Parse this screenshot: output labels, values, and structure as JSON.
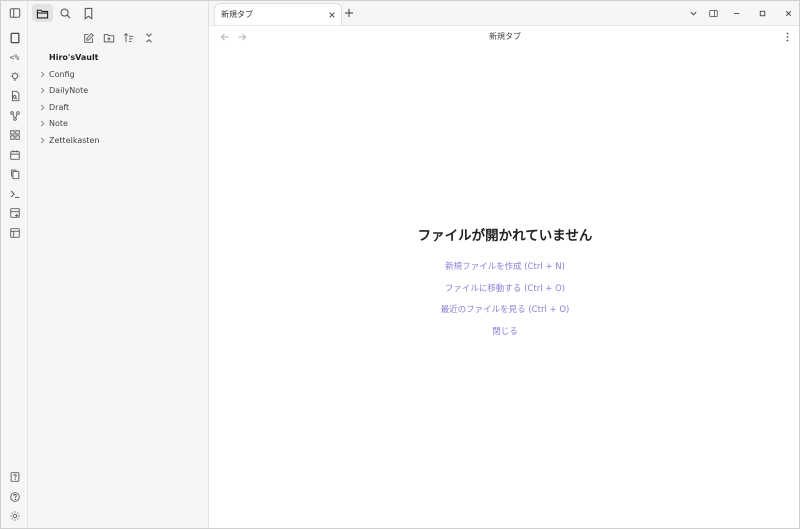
{
  "sidebar": {
    "vault_name": "Hiro'sVault",
    "folders": [
      {
        "label": "Config"
      },
      {
        "label": "DailyNote"
      },
      {
        "label": "Draft"
      },
      {
        "label": "Note"
      },
      {
        "label": "Zettelkasten"
      }
    ]
  },
  "tabs": [
    {
      "label": "新規タブ"
    }
  ],
  "view": {
    "title": "新規タブ",
    "empty_state": {
      "heading": "ファイルが開かれていません",
      "actions": [
        {
          "label": "新規ファイルを作成 (Ctrl + N)"
        },
        {
          "label": "ファイルに移動する (Ctrl + O)"
        },
        {
          "label": "最近のファイルを見る (Ctrl + O)"
        },
        {
          "label": "閉じる"
        }
      ]
    }
  },
  "ribbon": {
    "code_label": "<%"
  },
  "colors": {
    "accent": "#8a7ed6",
    "background": "#f6f6f6",
    "editor_background": "#ffffff"
  },
  "icons": {
    "ribbon": [
      "file-icon",
      "templater-icon",
      "lightbulb-icon",
      "file-search-icon",
      "graph-icon",
      "grid-icon",
      "calendar-icon",
      "copy-icon",
      "terminal-icon",
      "kanban-icon",
      "layout-icon"
    ],
    "ribbon_bottom": [
      "help-book-icon",
      "help-icon",
      "settings-icon"
    ],
    "sidebar_tabs": [
      "folder-icon",
      "search-icon",
      "bookmark-icon"
    ],
    "sidebar_actions": [
      "new-note-icon",
      "new-folder-icon",
      "sort-icon",
      "collapse-icon"
    ]
  }
}
